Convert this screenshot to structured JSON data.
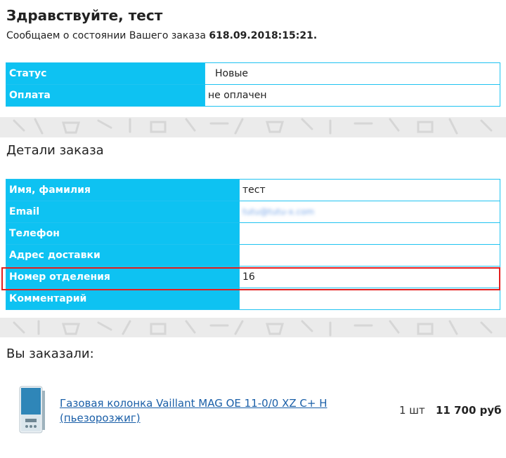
{
  "greeting": "Здравствуйте, тест",
  "intro": {
    "text": "Сообщаем о состоянии Вашего заказа ",
    "order_number": "618.09.2018:15:21."
  },
  "status_table": [
    {
      "label": "Статус",
      "value": "Новые"
    },
    {
      "label": "Оплата",
      "value": "не оплачен"
    }
  ],
  "details": {
    "title": "Детали заказа",
    "rows": [
      {
        "label": "Имя, фамилия",
        "value": "тест"
      },
      {
        "label": "Email",
        "value": "tutu@tutu-x.com"
      },
      {
        "label": "Телефон",
        "value": ""
      },
      {
        "label": "Адрес доставки",
        "value": ""
      },
      {
        "label": "Номер отделения",
        "value": "16"
      },
      {
        "label": "Комментарий",
        "value": ""
      }
    ]
  },
  "order": {
    "title": "Вы заказали:",
    "items": [
      {
        "name": "Газовая колонка Vaillant MAG OE 11-0/0 XZ C+ H (пьезорозжиг)",
        "qty": "1 шт",
        "price": "11 700 руб"
      }
    ]
  },
  "colors": {
    "header_cell": "#0ec2f2",
    "border": "#1fc3f1",
    "highlight": "#e31e1e",
    "link": "#1a5fa8"
  }
}
